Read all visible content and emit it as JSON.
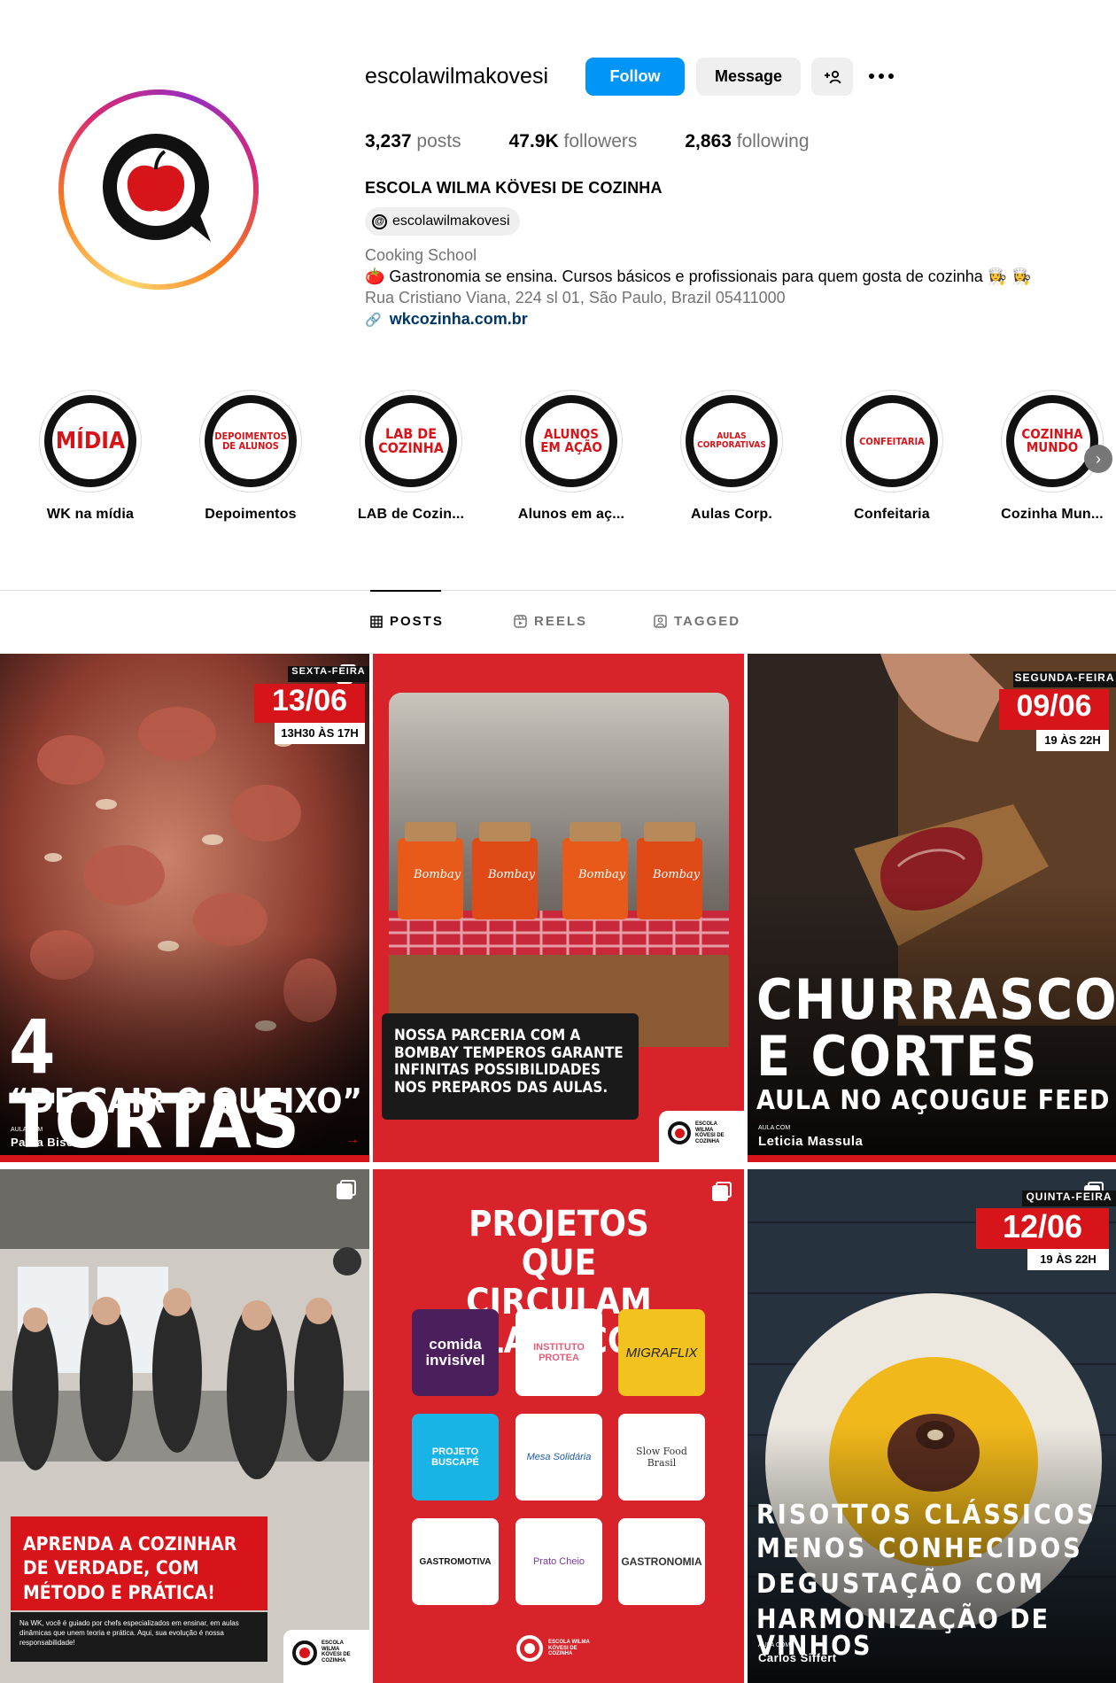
{
  "profile": {
    "username": "escolawilmakovesi",
    "follow_label": "Follow",
    "message_label": "Message",
    "add_user_glyph": "+👤",
    "posts_count": "3,237",
    "posts_label": "posts",
    "followers_count": "47.9K",
    "followers_label": "followers",
    "following_count": "2,863",
    "following_label": "following",
    "full_name": "ESCOLA WILMA KÖVESI DE COZINHA",
    "threads_handle": "escolawilmakovesi",
    "category": "Cooking School",
    "bio": "🍅 Gastronomia se ensina. Cursos básicos e profissionais para quem gosta de cozinha 👩‍🍳 👩‍🍳",
    "address": "Rua Cristiano Viana, 224 sl 01, São Paulo, Brazil 05411000",
    "website": "wkcozinha.com.br"
  },
  "highlights": [
    {
      "cover": "MÍDIA",
      "label": "WK na mídia"
    },
    {
      "cover": "DEPOIMENTOS DE ALUNOS",
      "label": "Depoimentos"
    },
    {
      "cover": "LAB DE COZINHA",
      "label": "LAB de Cozin..."
    },
    {
      "cover": "ALUNOS EM AÇÃO",
      "label": "Alunos em aç..."
    },
    {
      "cover": "AULAS CORPORATIVAS",
      "label": "Aulas Corp."
    },
    {
      "cover": "CONFEITARIA",
      "label": "Confeitaria"
    },
    {
      "cover": "COZINHA MUNDO",
      "label": "Cozinha Mun..."
    }
  ],
  "tabs": [
    {
      "label": "POSTS",
      "icon": "grid-icon"
    },
    {
      "label": "REELS",
      "icon": "reels-icon"
    },
    {
      "label": "TAGGED",
      "icon": "tagged-icon"
    }
  ],
  "posts": {
    "p1": {
      "day": "SEXTA-FEIRA",
      "date": "13/06",
      "time": "13H30 ÀS 17H",
      "title": "4 TORTAS",
      "subtitle": "“DE CAIR O QUEIXO”",
      "class_with": "AULA COM",
      "chef": "Paola Biselli"
    },
    "p2": {
      "caption": "NOSSA PARCERIA COM A BOMBAY TEMPEROS GARANTE INFINITAS POSSIBILIDADES NOS PREPAROS DAS AULAS.",
      "jar_brand": "Bombay",
      "logo_text": "ESCOLA WILMA KÖVESI DE COZINHA"
    },
    "p3": {
      "day": "SEGUNDA-FEIRA",
      "date": "09/06",
      "time": "19 ÀS 22H",
      "title_line1": "CHURRASCO",
      "title_line2": "E CORTES",
      "subtitle": "AULA NO AÇOUGUE FEED",
      "class_with": "AULA COM",
      "chef": "Leticia Massula"
    },
    "p4": {
      "headline": "APRENDA A COZINHAR DE VERDADE, COM MÉTODO E PRÁTICA!",
      "body": "Na WK, você é guiado por chefs especializados em ensinar, em aulas dinâmicas que unem teoria e prática. Aqui, sua evolução é nossa responsabilidade!",
      "logo_text": "ESCOLA WILMA KÖVESI DE COZINHA"
    },
    "p5": {
      "title": "PROJETOS QUE CIRCULAM PELA ESCOLA",
      "tiles": [
        "comida invisível",
        "INSTITUTO PROTEA",
        "MIGRAFLIX",
        "PROJETO BUSCAPÉ",
        "Mesa Solidária",
        "Slow Food Brasil",
        "GASTROMOTIVA",
        "Prato Cheio",
        "GASTRONOMIA"
      ],
      "logo_text": "ESCOLA WILMA KÖVESI DE COZINHA"
    },
    "p6": {
      "day": "QUINTA-FEIRA",
      "date": "12/06",
      "time": "19 ÀS 22H",
      "title_lines": [
        "RISOTTOS CLÁSSICOS",
        "MENOS CONHECIDOS",
        "DEGUSTAÇÃO COM",
        "HARMONIZAÇÃO DE VINHOS"
      ],
      "class_with": "AULA COM",
      "chef": "Carlos Siffert"
    }
  }
}
